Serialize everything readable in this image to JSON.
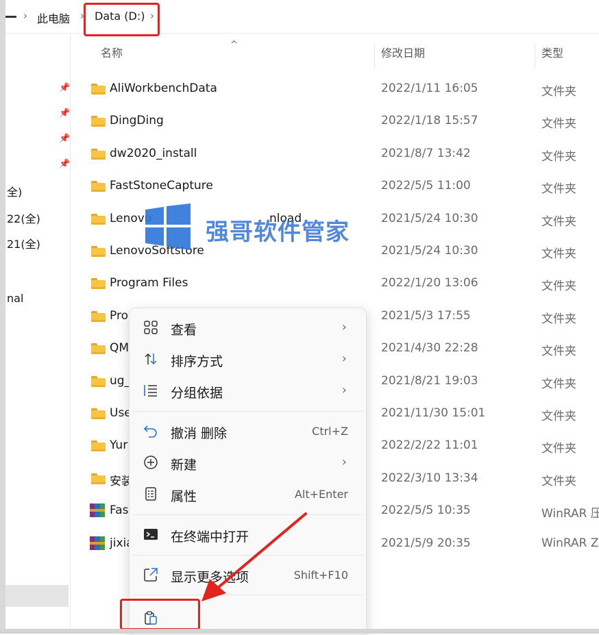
{
  "breadcrumb": {
    "items": [
      "此电脑",
      "Data (D:)"
    ],
    "separator": "›"
  },
  "columns": {
    "name": "名称",
    "date": "修改日期",
    "type": "类型"
  },
  "nav": {
    "items": [
      "全)",
      "22(全)",
      "21(全)",
      "nal"
    ]
  },
  "files": [
    {
      "name": "AliWorkbenchData",
      "date": "2022/1/11 16:05",
      "type": "文件夹",
      "icon": "folder-icon"
    },
    {
      "name": "DingDing",
      "date": "2022/1/18 15:57",
      "type": "文件夹",
      "icon": "folder-icon"
    },
    {
      "name": "dw2020_install",
      "date": "2021/8/7 13:42",
      "type": "文件夹",
      "icon": "folder-icon"
    },
    {
      "name": "FastStoneCapture",
      "date": "2022/5/5 11:00",
      "type": "文件夹",
      "icon": "folder-icon"
    },
    {
      "name": "Lenovo",
      "tail": "nload",
      "date": "2021/5/24 10:30",
      "type": "文件夹",
      "icon": "folder-icon"
    },
    {
      "name": "LenovoSoftstore",
      "date": "2021/5/24 10:30",
      "type": "文件夹",
      "icon": "folder-icon"
    },
    {
      "name": "Program Files",
      "date": "2022/1/20 13:06",
      "type": "文件夹",
      "icon": "folder-icon"
    },
    {
      "name": "Pro",
      "date": "2021/5/3 17:55",
      "type": "文件夹",
      "icon": "folder-icon"
    },
    {
      "name": "QM",
      "date": "2021/4/30 22:28",
      "type": "文件夹",
      "icon": "folder-icon"
    },
    {
      "name": "ug_",
      "date": "2021/8/21 19:03",
      "type": "文件夹",
      "icon": "folder-icon"
    },
    {
      "name": "Use",
      "date": "2021/11/30 15:01",
      "type": "文件夹",
      "icon": "folder-icon"
    },
    {
      "name": "Yur",
      "date": "2022/2/22 11:01",
      "type": "文件夹",
      "icon": "folder-icon"
    },
    {
      "name": "安装",
      "date": "2022/3/10 13:34",
      "type": "文件夹",
      "icon": "folder-icon"
    },
    {
      "name": "Fas",
      "date": "2022/5/5 10:35",
      "type": "WinRAR 压",
      "icon": "winrar-icon"
    },
    {
      "name": "jixia",
      "date": "2021/5/9 20:35",
      "type": "WinRAR Z",
      "icon": "winrar-icon"
    }
  ],
  "context_menu": {
    "items": [
      {
        "label": "查看",
        "shortcut": "",
        "submenu": true,
        "icon": "grid-view-icon"
      },
      {
        "label": "排序方式",
        "shortcut": "",
        "submenu": true,
        "icon": "sort-icon"
      },
      {
        "label": "分组依据",
        "shortcut": "",
        "submenu": true,
        "icon": "group-by-icon"
      },
      {
        "label": "撤消 删除",
        "shortcut": "Ctrl+Z",
        "submenu": false,
        "icon": "undo-icon"
      },
      {
        "label": "新建",
        "shortcut": "",
        "submenu": true,
        "icon": "new-plus-icon"
      },
      {
        "label": "属性",
        "shortcut": "Alt+Enter",
        "submenu": false,
        "icon": "properties-icon"
      },
      {
        "label": "在终端中打开",
        "shortcut": "",
        "submenu": false,
        "icon": "terminal-icon"
      },
      {
        "label": "显示更多选项",
        "shortcut": "Shift+F10",
        "submenu": false,
        "icon": "more-options-icon"
      }
    ],
    "chevron": "›"
  },
  "watermark": {
    "text": "强哥软件管家"
  },
  "colors": {
    "annotation_red": "#e3231f",
    "folder_yellow": "#f7c443",
    "watermark_blue": "#2b6fd6"
  }
}
